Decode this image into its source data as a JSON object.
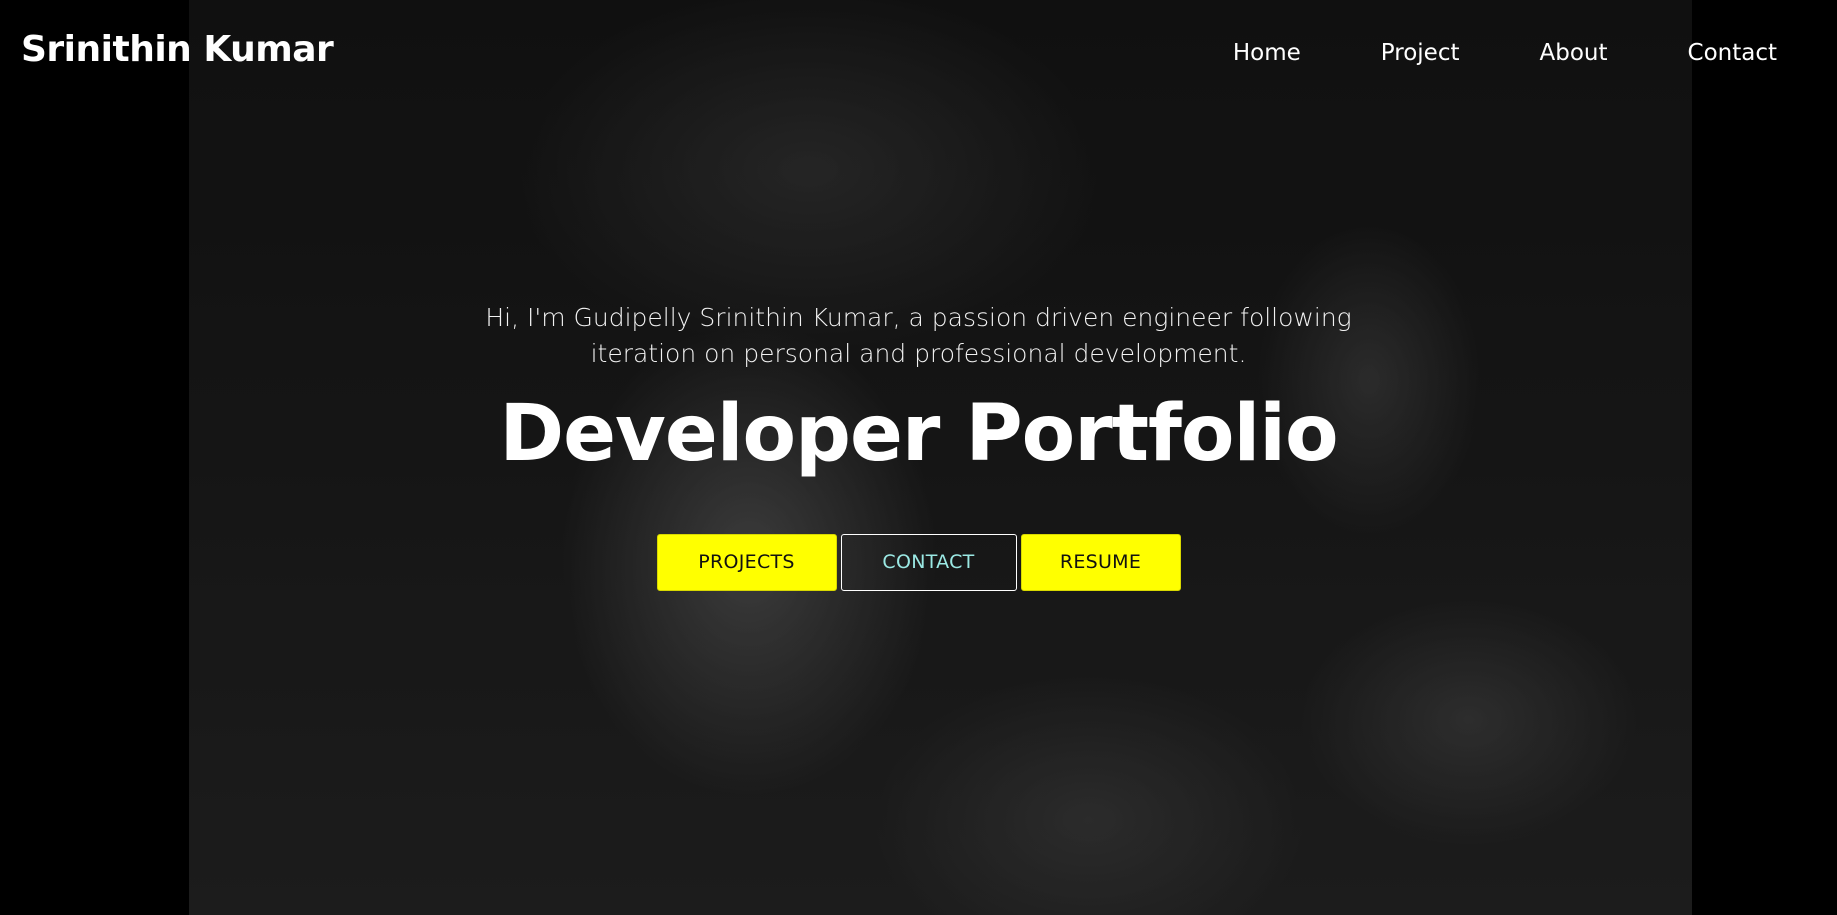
{
  "header": {
    "brand": "Srinithin Kumar",
    "nav": [
      {
        "label": "Home"
      },
      {
        "label": "Project"
      },
      {
        "label": "About"
      },
      {
        "label": "Contact"
      }
    ]
  },
  "hero": {
    "intro": "Hi, I'm Gudipelly Srinithin Kumar, a passion driven engineer following iteration on personal and professional development.",
    "title": "Developer Portfolio",
    "buttons": {
      "projects": "PROJECTS",
      "contact": "CONTACT",
      "resume": "RESUME"
    }
  },
  "colors": {
    "background": "#000000",
    "accent": "#ffff00",
    "contact_text": "#9be9e4",
    "text": "#ffffff"
  }
}
